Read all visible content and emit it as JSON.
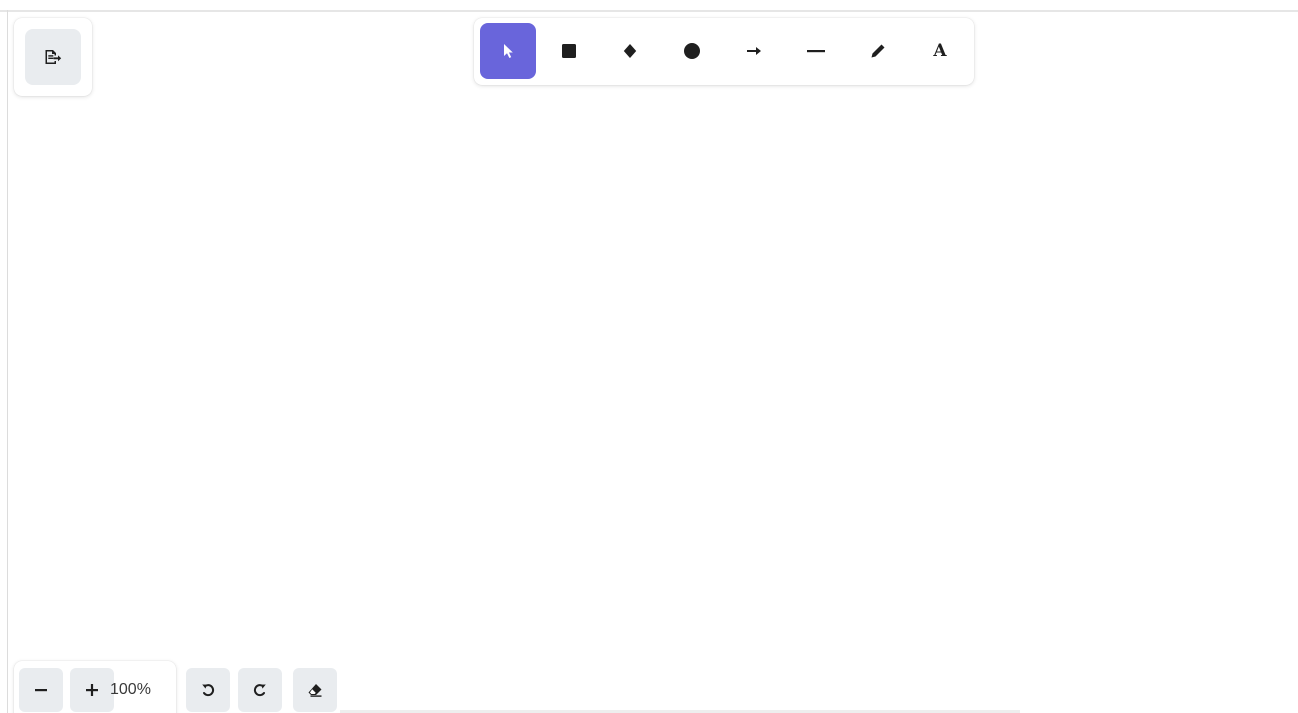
{
  "sidebar": {
    "export_button": {
      "icon": "file-export-icon"
    }
  },
  "toolbar": {
    "tools": [
      {
        "id": "select",
        "icon": "pointer-icon",
        "active": true
      },
      {
        "id": "rectangle",
        "icon": "square-icon",
        "active": false
      },
      {
        "id": "diamond",
        "icon": "diamond-icon",
        "active": false
      },
      {
        "id": "ellipse",
        "icon": "circle-icon",
        "active": false
      },
      {
        "id": "arrow",
        "icon": "arrow-right-icon",
        "active": false
      },
      {
        "id": "line",
        "icon": "line-icon",
        "active": false
      },
      {
        "id": "draw",
        "icon": "pencil-icon",
        "active": false
      },
      {
        "id": "text",
        "icon": "text-icon",
        "label": "A",
        "active": false
      }
    ],
    "active_color": "#6965db"
  },
  "footer": {
    "zoom_out_icon": "minus-icon",
    "zoom_in_icon": "plus-icon",
    "zoom_level": "100%",
    "undo_icon": "undo-icon",
    "redo_icon": "redo-icon",
    "clear_icon": "eraser-icon"
  },
  "colors": {
    "button_bg": "#e9ecef",
    "accent": "#6965db",
    "icon": "#1f1f1f"
  }
}
